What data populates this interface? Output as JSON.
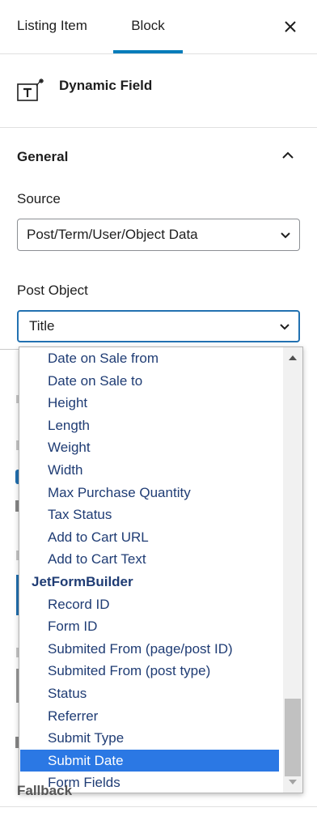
{
  "tabs": {
    "listing_item": "Listing Item",
    "block": "Block"
  },
  "block": {
    "title": "Dynamic Field",
    "icon": "dynamic-field-icon"
  },
  "general": {
    "title": "General"
  },
  "source": {
    "label": "Source",
    "value": "Post/Term/User/Object Data"
  },
  "post_object": {
    "label": "Post Object",
    "value": "Title"
  },
  "dropdown": {
    "options": [
      {
        "label": "Date on Sale from"
      },
      {
        "label": "Date on Sale to"
      },
      {
        "label": "Height"
      },
      {
        "label": "Length"
      },
      {
        "label": "Weight"
      },
      {
        "label": "Width"
      },
      {
        "label": "Max Purchase Quantity"
      },
      {
        "label": "Tax Status"
      },
      {
        "label": "Add to Cart URL"
      },
      {
        "label": "Add to Cart Text"
      },
      {
        "label": "JetFormBuilder"
      },
      {
        "label": "Record ID"
      },
      {
        "label": "Form ID"
      },
      {
        "label": "Submited From (page/post ID)"
      },
      {
        "label": "Submited From (post type)"
      },
      {
        "label": "Status"
      },
      {
        "label": "Referrer"
      },
      {
        "label": "Submit Type"
      },
      {
        "label": "Submit Date"
      },
      {
        "label": "Form Fields"
      }
    ],
    "selected": "Submit Date",
    "group_header": "JetFormBuilder"
  },
  "fallback_label": "Fallback",
  "colors": {
    "accent": "#007cba",
    "selected_bg": "#2b78e4",
    "option_text": "#1f3c74"
  }
}
